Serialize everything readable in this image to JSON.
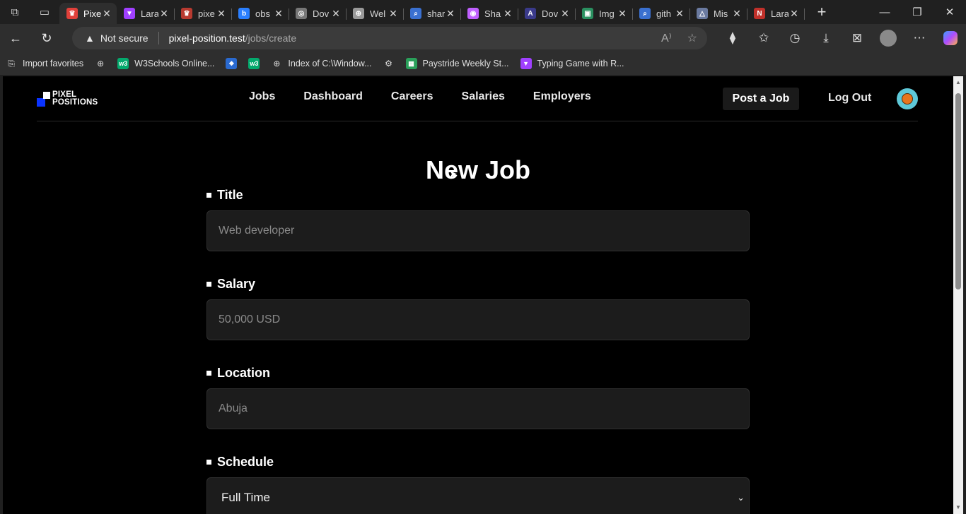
{
  "browser": {
    "tabs": [
      {
        "label": "Pixel",
        "icon": "laravel-icon",
        "color": "#e0403a",
        "active": true
      },
      {
        "label": "Lara",
        "icon": "vite-icon",
        "color": "#a040ff"
      },
      {
        "label": "pixe",
        "icon": "laravel-icon",
        "color": "#b83a30"
      },
      {
        "label": "obs",
        "icon": "bing-icon",
        "color": "#2a7fff"
      },
      {
        "label": "Dov",
        "icon": "github-icon",
        "color": "#777777"
      },
      {
        "label": "Wel",
        "icon": "globe-icon",
        "color": "#9a9a9a"
      },
      {
        "label": "shar",
        "icon": "search-icon",
        "color": "#3a70d0"
      },
      {
        "label": "Sha",
        "icon": "colorwheel-icon",
        "color": "#c060ff"
      },
      {
        "label": "Dov",
        "icon": "art-icon",
        "color": "#3a3a8a"
      },
      {
        "label": "Img",
        "icon": "image-icon",
        "color": "#2a9060"
      },
      {
        "label": "gith",
        "icon": "search-icon",
        "color": "#3a70d0"
      },
      {
        "label": "Mis",
        "icon": "triangle-icon",
        "color": "#6a7aa0"
      },
      {
        "label": "Lara",
        "icon": "in-icon",
        "color": "#c0302a"
      }
    ],
    "address": {
      "security": "Not secure",
      "host": "pixel-position.test",
      "path": "/jobs/create"
    },
    "bookmarks": [
      {
        "label": "Import favorites",
        "icon": "import-icon"
      },
      {
        "label": "",
        "icon": "globe-icon"
      },
      {
        "label": "W3Schools Online...",
        "icon": "w3-icon"
      },
      {
        "label": "",
        "icon": "puzzle-icon"
      },
      {
        "label": "",
        "icon": "w3-icon"
      },
      {
        "label": "Index of C:\\Window...",
        "icon": "globe-icon"
      },
      {
        "label": "",
        "icon": "gear-icon"
      },
      {
        "label": "Paystride Weekly St...",
        "icon": "sheets-icon"
      },
      {
        "label": "Typing Game with R...",
        "icon": "vite-icon"
      }
    ]
  },
  "site": {
    "logo_line1": "PIXEL",
    "logo_line2": "POSITIONS",
    "nav": [
      "Jobs",
      "Dashboard",
      "Careers",
      "Salaries",
      "Employers"
    ],
    "post_job": "Post a Job",
    "logout": "Log Out"
  },
  "form": {
    "title": "New Job",
    "fields": [
      {
        "label": "Title",
        "placeholder": "Web developer"
      },
      {
        "label": "Salary",
        "placeholder": "50,000 USD"
      },
      {
        "label": "Location",
        "placeholder": "Abuja"
      },
      {
        "label": "Schedule",
        "value": "Full Time"
      }
    ]
  }
}
